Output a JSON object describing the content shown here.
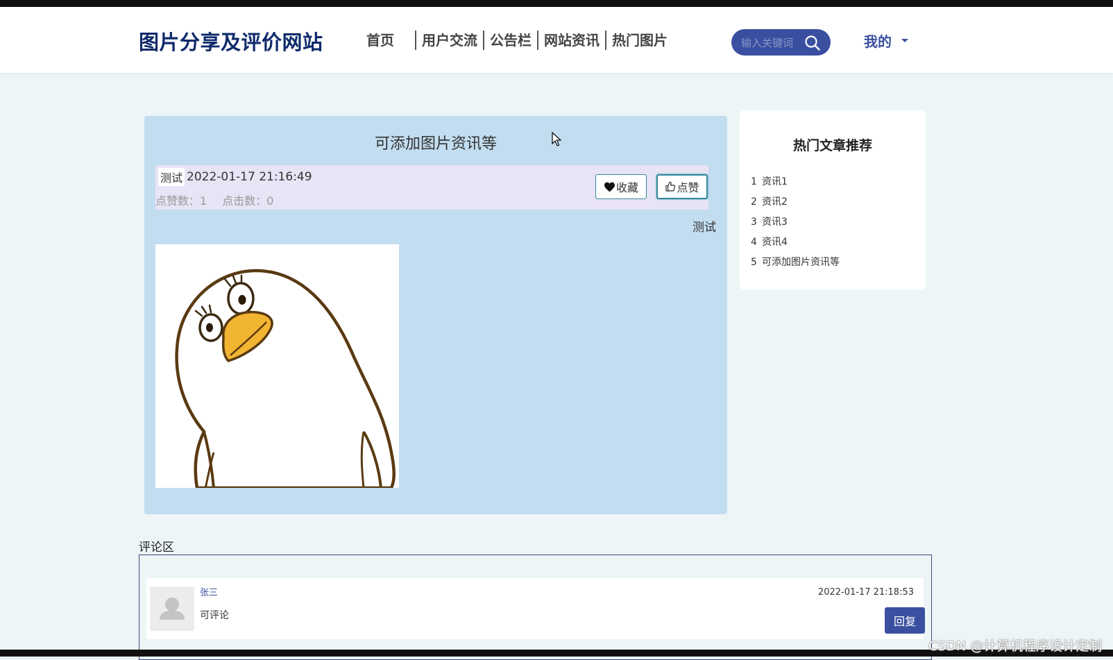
{
  "header": {
    "site_title": "图片分享及评价网站",
    "nav": [
      "首页",
      "用户交流",
      "公告栏",
      "网站资讯",
      "热门图片"
    ],
    "search_placeholder": "输入关键词",
    "mine_label": "我的"
  },
  "article": {
    "title": "可添加图片资讯等",
    "author": "测试",
    "date": "2022-01-17 21:16:49",
    "likes_label": "点赞数：1",
    "clicks_label": "点击数：0",
    "favorite_label": "收藏",
    "like_label": "点赞",
    "category": "测试",
    "image_icon": "penguin-illustration"
  },
  "sidebar": {
    "title": "热门文章推荐",
    "items": [
      {
        "num": "1",
        "label": "资讯1"
      },
      {
        "num": "2",
        "label": "资讯2"
      },
      {
        "num": "3",
        "label": "资讯3"
      },
      {
        "num": "4",
        "label": "资讯4"
      },
      {
        "num": "5",
        "label": "可添加图片资讯等"
      }
    ]
  },
  "comments": {
    "label": "评论区",
    "items": [
      {
        "user": "张三",
        "text": "可评论",
        "time": "2022-01-17 21:18:53",
        "reply_label": "回复"
      }
    ]
  },
  "watermark": "CSDN @计算机程序设计定制",
  "colors": {
    "brand": "#3a4fa0",
    "title_navy": "#0f2a6b",
    "article_bg": "#c2ddf0",
    "meta_bg": "#e8e4f5",
    "page_bg": "#edf5f7"
  }
}
